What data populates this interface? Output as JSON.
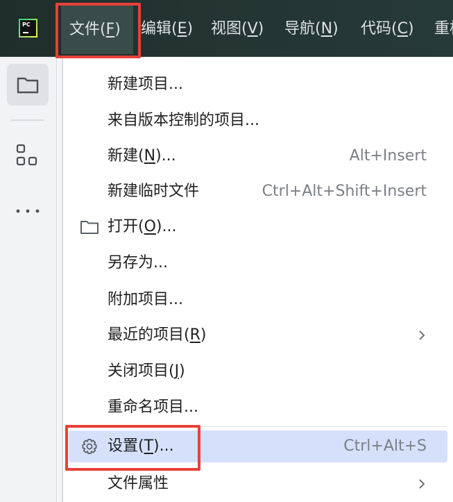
{
  "app": {
    "logo_text": "PC",
    "logo_icon": "pycharm-logo-icon"
  },
  "menubar": {
    "items": [
      {
        "label": "文件(",
        "mnemonic": "F",
        "suffix": ")"
      },
      {
        "label": "编辑(",
        "mnemonic": "E",
        "suffix": ")"
      },
      {
        "label": "视图(",
        "mnemonic": "V",
        "suffix": ")"
      },
      {
        "label": "导航(",
        "mnemonic": "N",
        "suffix": ")"
      },
      {
        "label": "代码(",
        "mnemonic": "C",
        "suffix": ")"
      },
      {
        "label": "重构",
        "mnemonic": "",
        "suffix": ""
      }
    ]
  },
  "toolstrip": {
    "items": [
      {
        "name": "project",
        "icon": "folder-icon",
        "selected": true
      },
      {
        "name": "structure",
        "icon": "structure-icon",
        "selected": false
      },
      {
        "name": "more",
        "icon": "more-icon",
        "selected": false
      }
    ]
  },
  "file_menu": {
    "items": [
      {
        "label": "新建项目...",
        "shortcut": "",
        "submenu": false
      },
      {
        "label": "来自版本控制的项目...",
        "shortcut": "",
        "submenu": false
      },
      {
        "label_pre": "新建(",
        "mnemonic": "N",
        "label_post": ")...",
        "shortcut": "Alt+Insert",
        "submenu": false
      },
      {
        "label": "新建临时文件",
        "shortcut": "Ctrl+Alt+Shift+Insert",
        "submenu": false
      },
      {
        "label_pre": "打开(",
        "mnemonic": "O",
        "label_post": ")...",
        "shortcut": "",
        "icon": "folder-icon",
        "submenu": false
      },
      {
        "label": "另存为...",
        "shortcut": "",
        "submenu": false
      },
      {
        "label": "附加项目...",
        "shortcut": "",
        "submenu": false
      },
      {
        "label_pre": "最近的项目(",
        "mnemonic": "R",
        "label_post": ")",
        "shortcut": "",
        "submenu": true
      },
      {
        "label_pre": "关闭项目(",
        "mnemonic": "J",
        "label_post": ")",
        "shortcut": "",
        "submenu": false
      },
      {
        "label": "重命名项目...",
        "shortcut": "",
        "submenu": false
      },
      {
        "label_pre": "设置(",
        "mnemonic": "T",
        "label_post": ")...",
        "shortcut": "Ctrl+Alt+S",
        "icon": "gear-icon",
        "submenu": false,
        "highlighted": true
      },
      {
        "label": "文件属性",
        "shortcut": "",
        "submenu": true
      }
    ]
  },
  "colors": {
    "menubar_bg": "#243532",
    "highlight_bg": "#d5e1fb",
    "annotation": "#e8413b",
    "shortcut_text": "#7b7f86"
  }
}
